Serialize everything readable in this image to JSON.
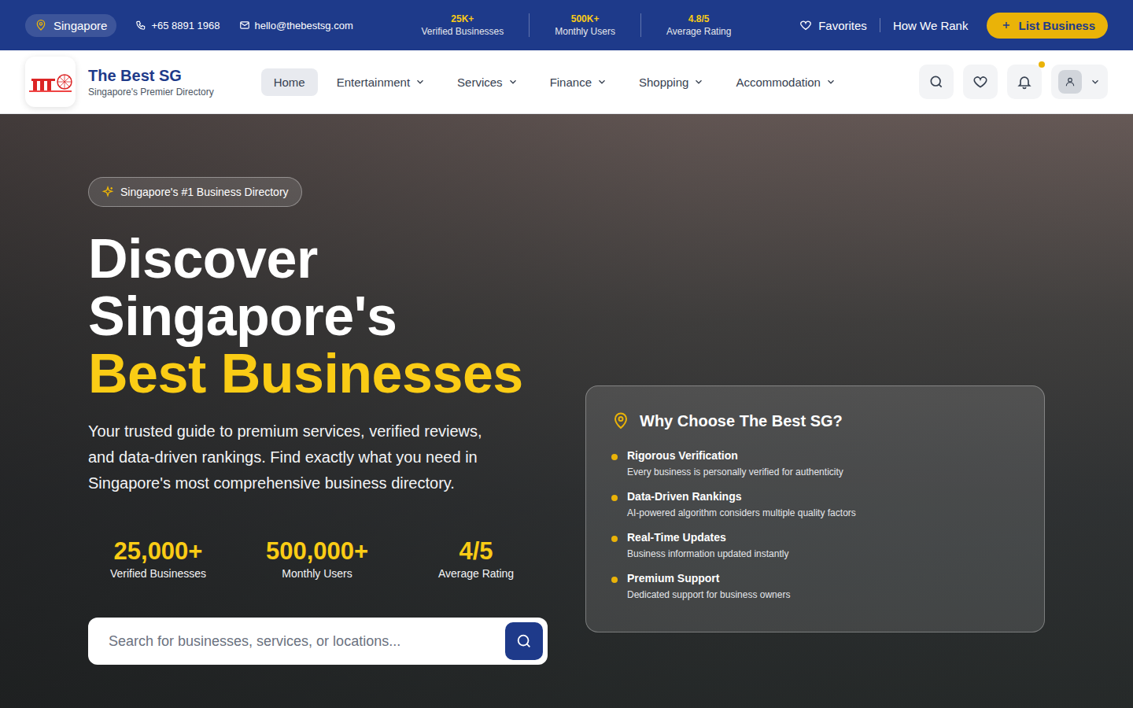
{
  "topbar": {
    "location": "Singapore",
    "phone": "+65 8891 1968",
    "email": "hello@thebestsg.com",
    "stats": [
      {
        "value": "25K+",
        "label": "Verified Businesses"
      },
      {
        "value": "500K+",
        "label": "Monthly Users"
      },
      {
        "value": "4.8/5",
        "label": "Average Rating"
      }
    ],
    "favorites": "Favorites",
    "how_we_rank": "How We Rank",
    "cta": "List Business"
  },
  "navbar": {
    "brand": {
      "name": "The Best SG",
      "tagline": "Singapore's Premier Directory"
    },
    "menu": [
      {
        "label": "Home",
        "selected": true,
        "dropdown": false
      },
      {
        "label": "Entertainment",
        "selected": false,
        "dropdown": true
      },
      {
        "label": "Services",
        "selected": false,
        "dropdown": true
      },
      {
        "label": "Finance",
        "selected": false,
        "dropdown": true
      },
      {
        "label": "Shopping",
        "selected": false,
        "dropdown": true
      },
      {
        "label": "Accommodation",
        "selected": false,
        "dropdown": true
      }
    ],
    "notifications": {
      "unread": true
    }
  },
  "hero": {
    "badge": "Singapore's #1 Business Directory",
    "title": [
      "Discover",
      "Singapore's"
    ],
    "highlight": "Best Businesses",
    "description": "Your trusted guide to premium services, verified reviews, and data-driven rankings. Find exactly what you need in Singapore's most comprehensive business directory.",
    "stats": [
      {
        "value": "25,000+",
        "label": "Verified Businesses"
      },
      {
        "value": "500,000+",
        "label": "Monthly Users"
      },
      {
        "value": "4/5",
        "label": "Average Rating"
      }
    ],
    "search": {
      "placeholder": "Search for businesses, services, or locations..."
    }
  },
  "why_card": {
    "title": "Why Choose The Best SG?",
    "items": [
      {
        "title": "Rigorous Verification",
        "description": "Every business is personally verified for authenticity"
      },
      {
        "title": "Data-Driven Rankings",
        "description": "AI-powered algorithm considers multiple quality factors"
      },
      {
        "title": "Real-Time Updates",
        "description": "Business information updated instantly"
      },
      {
        "title": "Premium Support",
        "description": "Dedicated support for business owners"
      }
    ]
  }
}
